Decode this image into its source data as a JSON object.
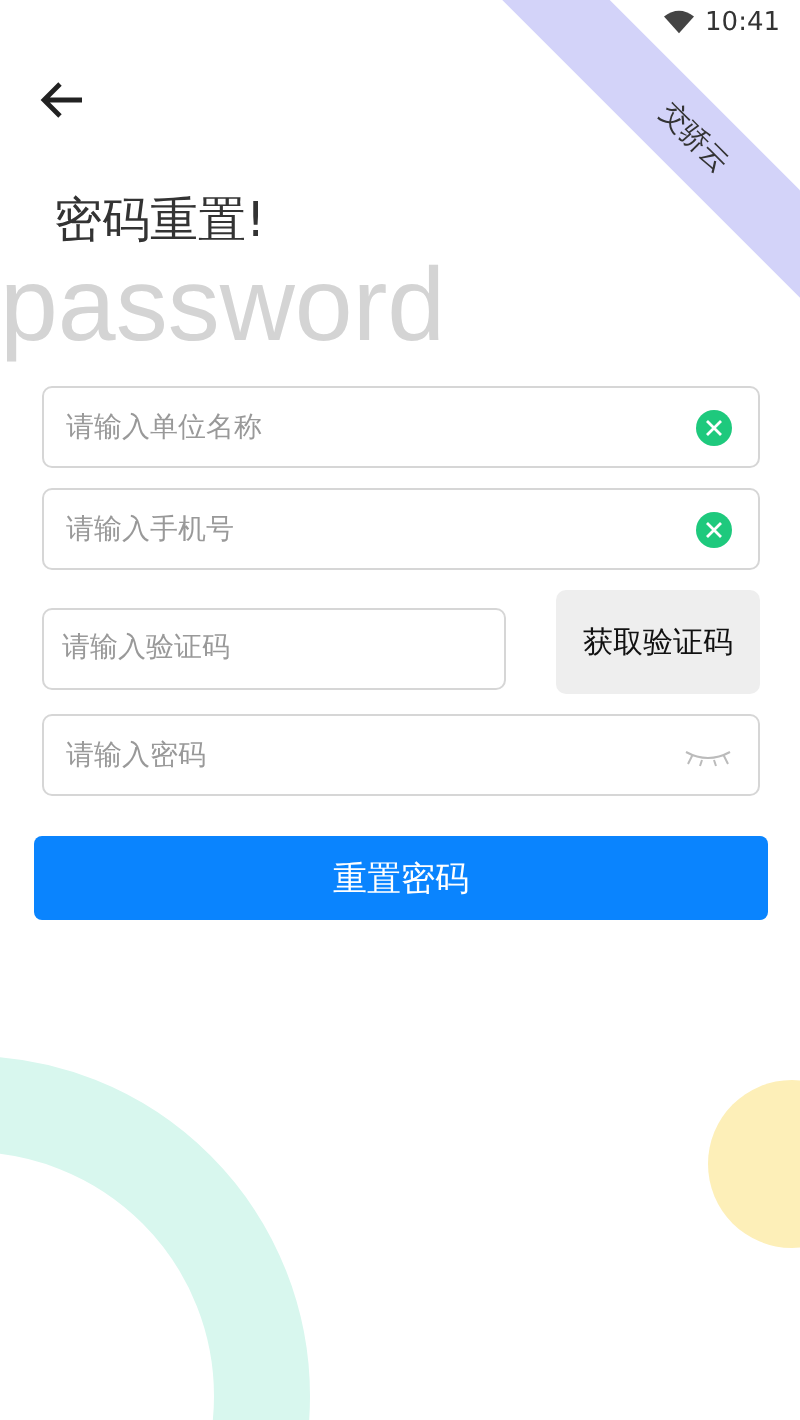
{
  "status_bar": {
    "time": "10:41"
  },
  "banner": {
    "text": "交骄云"
  },
  "background_word": "password",
  "title": "密码重置!",
  "fields": [
    {
      "kind": "clear",
      "placeholder": "请输入单位名称"
    },
    {
      "kind": "clear",
      "placeholder": "请输入手机号"
    },
    {
      "kind": "code",
      "placeholder": "请输入验证码",
      "button": "获取验证码"
    },
    {
      "kind": "password",
      "placeholder": "请输入密码"
    }
  ],
  "submit": "重置密码"
}
